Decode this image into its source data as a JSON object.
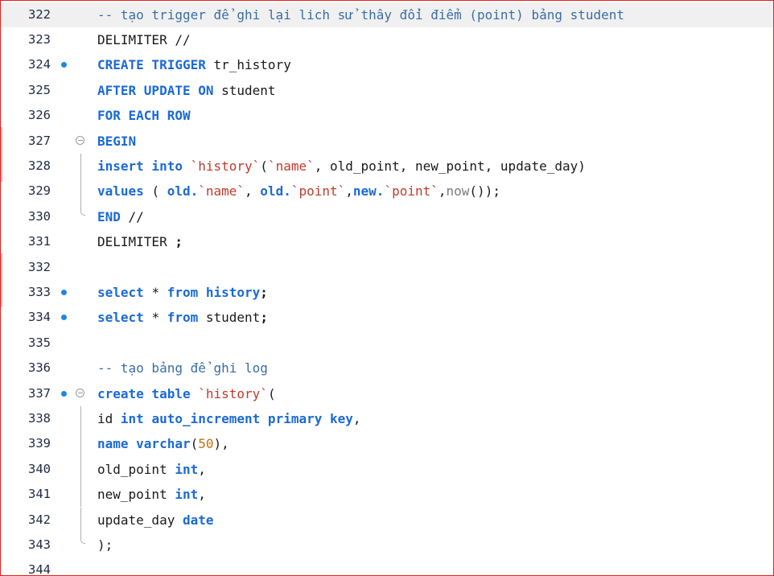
{
  "editor": {
    "lines": [
      {
        "num": "322",
        "highlight": true,
        "tokens": [
          {
            "t": "c",
            "s": "-- tạo trigger để ghi lại lich sử thây đổi điểm (point) bảng student"
          }
        ]
      },
      {
        "num": "323",
        "tokens": [
          {
            "t": "t",
            "s": "DELIMITER //"
          }
        ]
      },
      {
        "num": "324",
        "breakpoint": true,
        "tokens": [
          {
            "t": "k",
            "s": "CREATE TRIGGER "
          },
          {
            "t": "t",
            "s": "tr_history"
          }
        ]
      },
      {
        "num": "325",
        "tokens": [
          {
            "t": "k",
            "s": "AFTER UPDATE ON "
          },
          {
            "t": "t",
            "s": "student"
          }
        ]
      },
      {
        "num": "326",
        "tokens": [
          {
            "t": "k",
            "s": "FOR EACH ROW"
          }
        ]
      },
      {
        "num": "327",
        "fold": "start",
        "tokens": [
          {
            "t": "k",
            "s": "BEGIN"
          }
        ]
      },
      {
        "num": "328",
        "fold": "bar",
        "tokens": [
          {
            "t": "k",
            "s": "insert into "
          },
          {
            "t": "s",
            "s": "`history`"
          },
          {
            "t": "t",
            "s": "("
          },
          {
            "t": "s",
            "s": "`name`"
          },
          {
            "t": "t",
            "s": ", old_point, new_point, update_day)"
          }
        ]
      },
      {
        "num": "329",
        "fold": "bar",
        "tokens": [
          {
            "t": "k",
            "s": "values "
          },
          {
            "t": "t",
            "s": "( "
          },
          {
            "t": "k",
            "s": "old."
          },
          {
            "t": "s",
            "s": "`name`"
          },
          {
            "t": "t",
            "s": ", "
          },
          {
            "t": "k",
            "s": "old."
          },
          {
            "t": "s",
            "s": "`point`"
          },
          {
            "t": "t",
            "s": ","
          },
          {
            "t": "k",
            "s": "new."
          },
          {
            "t": "s",
            "s": "`point`"
          },
          {
            "t": "t",
            "s": ","
          },
          {
            "t": "f",
            "s": "now"
          },
          {
            "t": "t",
            "s": "());"
          }
        ]
      },
      {
        "num": "330",
        "fold": "end",
        "tokens": [
          {
            "t": "k",
            "s": "END "
          },
          {
            "t": "t",
            "s": "//"
          }
        ]
      },
      {
        "num": "331",
        "tokens": [
          {
            "t": "t",
            "s": "DELIMITER "
          },
          {
            "t": "p",
            "s": ";"
          }
        ]
      },
      {
        "num": "332",
        "tokens": []
      },
      {
        "num": "333",
        "breakpoint": true,
        "tokens": [
          {
            "t": "k",
            "s": "select "
          },
          {
            "t": "t",
            "s": "* "
          },
          {
            "t": "k",
            "s": "from history"
          },
          {
            "t": "p",
            "s": ";"
          }
        ]
      },
      {
        "num": "334",
        "breakpoint": true,
        "tokens": [
          {
            "t": "k",
            "s": "select "
          },
          {
            "t": "t",
            "s": "* "
          },
          {
            "t": "k",
            "s": "from "
          },
          {
            "t": "t",
            "s": "student"
          },
          {
            "t": "p",
            "s": ";"
          }
        ]
      },
      {
        "num": "335",
        "tokens": []
      },
      {
        "num": "336",
        "tokens": [
          {
            "t": "c",
            "s": "-- tạo bảng để ghi log"
          }
        ]
      },
      {
        "num": "337",
        "breakpoint": true,
        "fold": "start",
        "tokens": [
          {
            "t": "k",
            "s": "create table "
          },
          {
            "t": "s",
            "s": "`history`"
          },
          {
            "t": "t",
            "s": "("
          }
        ]
      },
      {
        "num": "338",
        "fold": "bar",
        "tokens": [
          {
            "t": "t",
            "s": "id "
          },
          {
            "t": "k",
            "s": "int auto_increment primary key"
          },
          {
            "t": "t",
            "s": ","
          }
        ]
      },
      {
        "num": "339",
        "fold": "bar",
        "tokens": [
          {
            "t": "k",
            "s": "name varchar"
          },
          {
            "t": "t",
            "s": "("
          },
          {
            "t": "n",
            "s": "50"
          },
          {
            "t": "t",
            "s": "),"
          }
        ]
      },
      {
        "num": "340",
        "fold": "bar",
        "tokens": [
          {
            "t": "t",
            "s": "old_point "
          },
          {
            "t": "k",
            "s": "int"
          },
          {
            "t": "t",
            "s": ","
          }
        ]
      },
      {
        "num": "341",
        "fold": "bar",
        "tokens": [
          {
            "t": "t",
            "s": "new_point "
          },
          {
            "t": "k",
            "s": "int"
          },
          {
            "t": "t",
            "s": ","
          }
        ]
      },
      {
        "num": "342",
        "fold": "bar",
        "tokens": [
          {
            "t": "t",
            "s": "update_day "
          },
          {
            "t": "k",
            "s": "date"
          }
        ]
      },
      {
        "num": "343",
        "fold": "end",
        "tokens": [
          {
            "t": "t",
            "s": ");"
          }
        ]
      },
      {
        "num": "344",
        "tokens": []
      }
    ]
  },
  "colors": {
    "comment": "#3a6ea5",
    "keyword": "#1b6ad6",
    "string": "#c43a2a",
    "number": "#c9700a",
    "breakpoint": "#1e88e5",
    "highlight": "#f0f0f0",
    "frame_border": "#e02020"
  },
  "icons": {
    "breakpoint": "breakpoint-dot-icon",
    "fold": "fold-collapse-icon"
  }
}
